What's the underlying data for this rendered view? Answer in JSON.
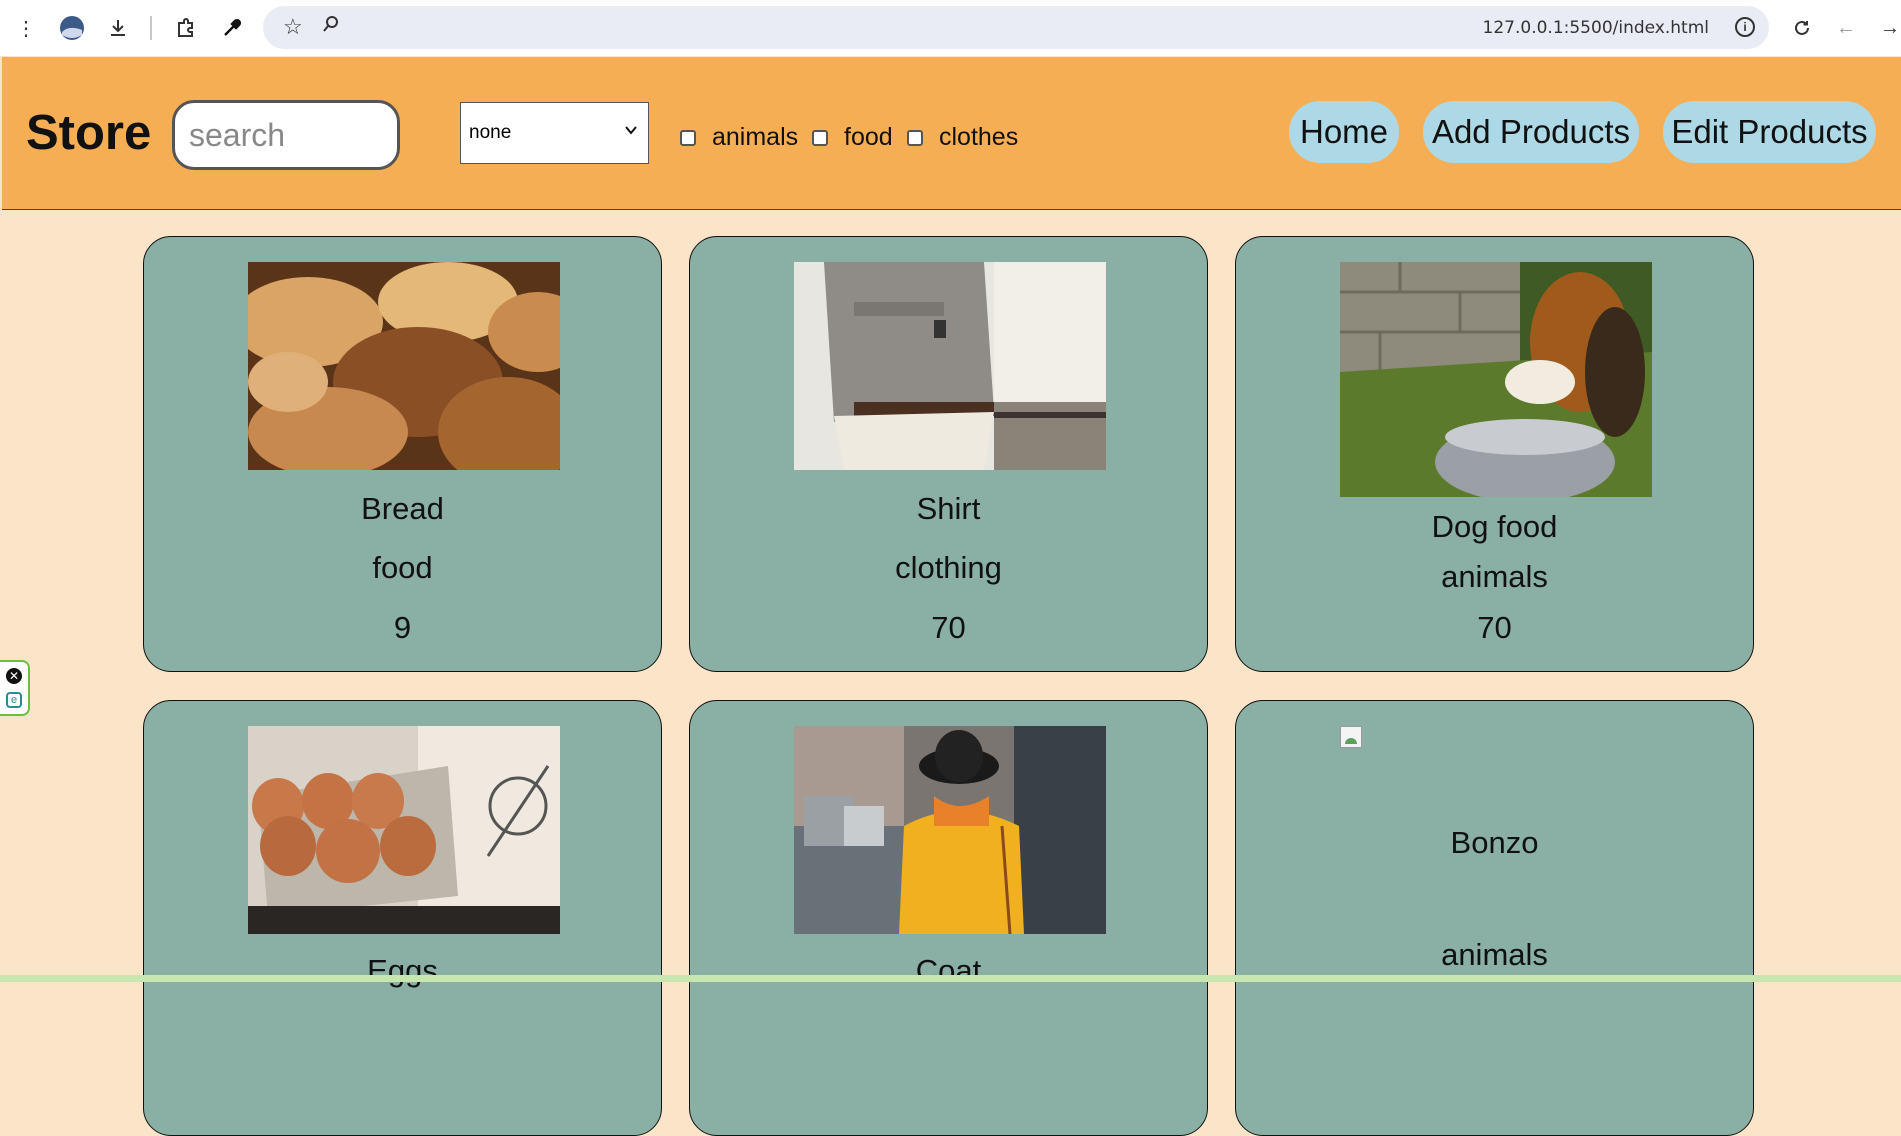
{
  "browser": {
    "url": "127.0.0.1:5500/index.html",
    "icons": [
      "menu-dots-icon",
      "profile-icon",
      "download-icon",
      "extensions-icon",
      "eyedropper-icon",
      "star-icon",
      "zoom-icon",
      "info-icon",
      "reload-icon",
      "back-icon",
      "forward-icon"
    ]
  },
  "header": {
    "title": "Store",
    "search_placeholder": "search",
    "sort_value": "none",
    "filters": [
      {
        "label": "animals",
        "checked": false
      },
      {
        "label": "food",
        "checked": false
      },
      {
        "label": "clothes",
        "checked": false
      }
    ],
    "nav": {
      "home": "Home",
      "add": "Add Products",
      "edit": "Edit Products"
    },
    "colors": {
      "header_bg": "#f6ae55",
      "nav_btn_bg": "#add8e6",
      "page_bg": "#fbe4c8",
      "card_bg": "#8aafa4"
    }
  },
  "products": [
    {
      "name": "Bread",
      "category": "food",
      "price": "9",
      "image": "bread-photo"
    },
    {
      "name": "Shirt",
      "category": "clothing",
      "price": "70",
      "image": "shirt-photo"
    },
    {
      "name": "Dog food",
      "category": "animals",
      "price": "70",
      "image": "dog-photo"
    },
    {
      "name": "Eggs",
      "category": "",
      "price": "",
      "image": "eggs-photo"
    },
    {
      "name": "Coat",
      "category": "",
      "price": "",
      "image": "coat-photo"
    },
    {
      "name": "Bonzo",
      "category": "animals",
      "price": "",
      "image": "broken-image"
    }
  ]
}
